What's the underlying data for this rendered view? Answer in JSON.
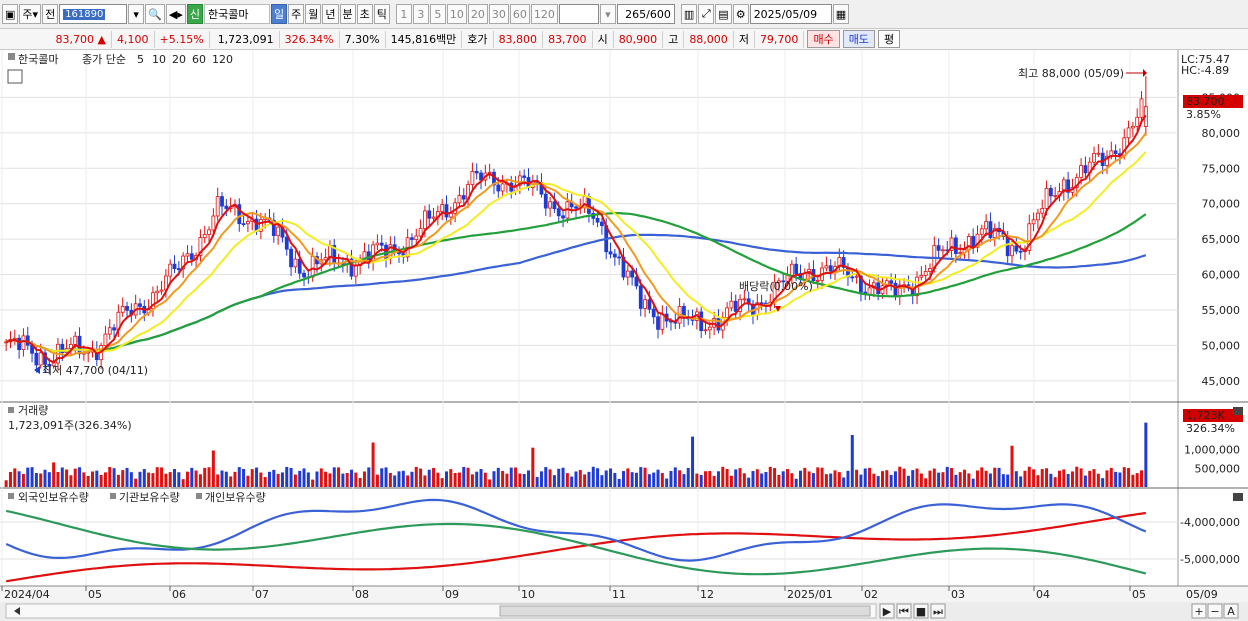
{
  "toolbar": {
    "type_label": "주",
    "prev_label": "전",
    "stock_code": "161890",
    "stock_name": "한국콜마",
    "credit_badge": "신",
    "periods": [
      "일",
      "주",
      "월",
      "년",
      "분",
      "초",
      "틱"
    ],
    "selected_period": "일",
    "intervals": [
      "1",
      "3",
      "5",
      "10",
      "20",
      "30",
      "60",
      "120"
    ],
    "count_value": "265",
    "count_total": "/600",
    "date_value": "2025/05/09"
  },
  "quote": {
    "price": "83,700",
    "change_arrow": "▲",
    "change": "4,100",
    "change_pct": "+5.15%",
    "volume": "1,723,091",
    "volume_ratio": "326.34%",
    "turnover_pct": "7.30%",
    "trade_value": "145,816백만",
    "ask_label": "호가",
    "ask1": "83,800",
    "ask2": "83,700",
    "open_label": "시",
    "open": "80,900",
    "high_label": "고",
    "high": "88,000",
    "low_label": "저",
    "low": "79,700",
    "buy_label": "매수",
    "sell_label": "매도",
    "eval_label": "평"
  },
  "price_panel": {
    "stock_label": "한국콜마",
    "ma_title": "종가 단순",
    "ma_legend": [
      {
        "label": "5",
        "color": "#e01010"
      },
      {
        "label": "10",
        "color": "#f09a20"
      },
      {
        "label": "20",
        "color": "#f4ec20"
      },
      {
        "label": "60",
        "color": "#23a03a"
      },
      {
        "label": "120",
        "color": "#3a62d6"
      }
    ],
    "lc_label": "LC:75.47",
    "hc_label": "HC:-4.89",
    "high_annotation": "최고 88,000 (05/09)",
    "low_annotation": "최저 47,700 (04/11)",
    "dividend_annotation": "배당락(0.00%)",
    "last_price_tag": "83,700",
    "last_pct_tag": "3.85%"
  },
  "volume_panel": {
    "title": "거래량",
    "value_text": "1,723,091주(326.34%)",
    "last_tag": "1,723K",
    "last_pct": "326.34%"
  },
  "holdings_panel": {
    "legend": [
      {
        "label": "외국인보유수량",
        "color": "#e01010"
      },
      {
        "label": "기관보유수량",
        "color": "#3a62d6"
      },
      {
        "label": "개인보유수량",
        "color": "#2e9a5a"
      }
    ]
  },
  "bottom_controls": [
    "▶",
    "⏮",
    "■",
    "⏭",
    "+",
    "−",
    "A"
  ],
  "chart_data": [
    {
      "type": "candlestick",
      "title": "한국콜마 종가 단순 5 10 20 60 120",
      "x_labels": [
        "2024/04",
        "05",
        "06",
        "07",
        "08",
        "09",
        "10",
        "11",
        "12",
        "2025/01",
        "02",
        "03",
        "04",
        "05"
      ],
      "last_x_label": "05/09",
      "y_ticks": [
        45000,
        50000,
        55000,
        60000,
        65000,
        70000,
        75000,
        80000,
        85000
      ],
      "ylim": [
        43000,
        90000
      ],
      "approx_close_path": [
        [
          "2024/04",
          50000
        ],
        [
          "04/11",
          48500
        ],
        [
          "05",
          49500
        ],
        [
          "05 mid",
          55000
        ],
        [
          "06",
          60000
        ],
        [
          "06 mid",
          69000
        ],
        [
          "07",
          68000
        ],
        [
          "07 mid",
          61000
        ],
        [
          "08",
          62000
        ],
        [
          "08 mid",
          63000
        ],
        [
          "09",
          67000
        ],
        [
          "09 mid",
          73000
        ],
        [
          "10",
          73500
        ],
        [
          "10 mid",
          70000
        ],
        [
          "11",
          68000
        ],
        [
          "11 mid",
          56000
        ],
        [
          "12",
          53000
        ],
        [
          "12 mid",
          54000
        ],
        [
          "2025/01",
          57000
        ],
        [
          "01 mid",
          61000
        ],
        [
          "02",
          60000
        ],
        [
          "02 mid",
          57000
        ],
        [
          "03",
          62000
        ],
        [
          "03 mid",
          66000
        ],
        [
          "04",
          64000
        ],
        [
          "04 mid",
          73000
        ],
        [
          "05",
          76000
        ],
        [
          "05/09",
          83700
        ]
      ],
      "annotations": {
        "high": 88000,
        "low": 47700,
        "last": 83700
      }
    },
    {
      "type": "bar",
      "title": "거래량",
      "y_ticks": [
        500000,
        1000000
      ],
      "last_value": 1723091
    },
    {
      "type": "line",
      "title": "외국인보유수량 기관보유수량 개인보유수량",
      "y_ticks": [
        -5000000,
        -4000000
      ],
      "series": [
        {
          "name": "외국인보유수량",
          "color": "#e01010"
        },
        {
          "name": "기관보유수량",
          "color": "#3a62d6"
        },
        {
          "name": "개인보유수량",
          "color": "#2e9a5a"
        }
      ]
    }
  ]
}
